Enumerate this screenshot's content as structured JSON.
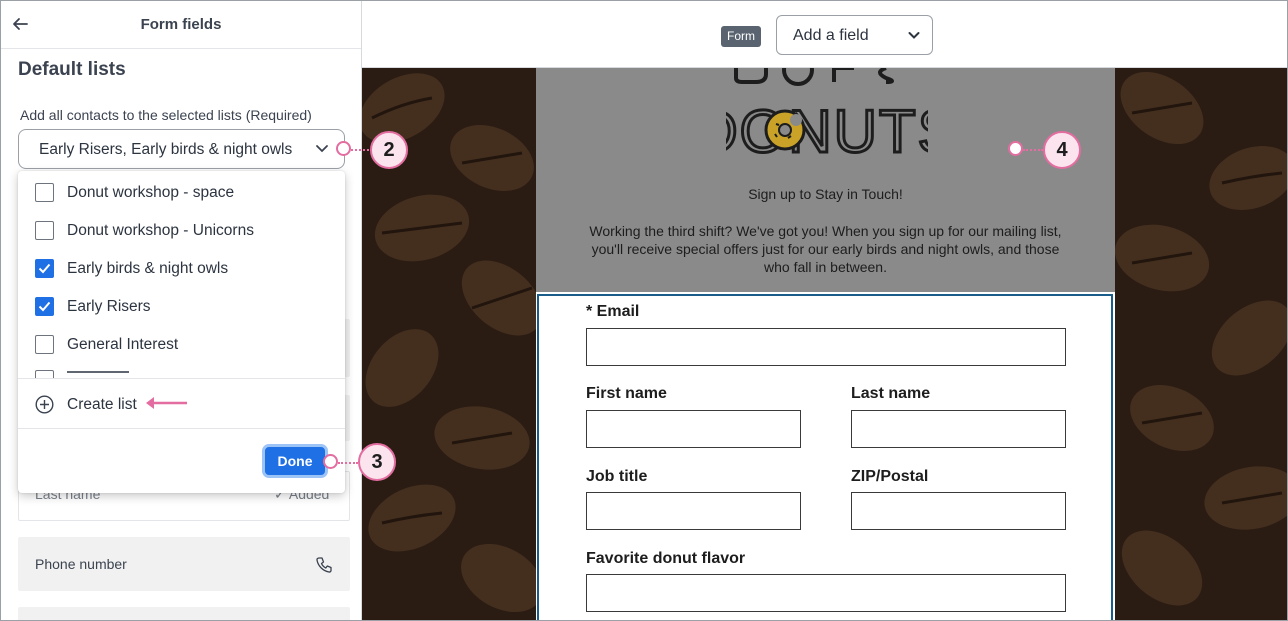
{
  "left_panel": {
    "header_title": "Form fields",
    "section_title": "Default lists",
    "lists_label": "Add all contacts to the selected lists",
    "lists_required": "(Required)",
    "selected_value": "Early Risers, Early birds & night owls",
    "options": [
      {
        "label": "Donut workshop - space",
        "checked": false
      },
      {
        "label": "Donut workshop - Unicorns",
        "checked": false
      },
      {
        "label": "Early birds & night owls",
        "checked": true
      },
      {
        "label": "Early Risers",
        "checked": true
      },
      {
        "label": "General Interest",
        "checked": false
      }
    ],
    "create_list_label": "Create list",
    "done_label": "Done",
    "behind_fields": {
      "last_name_label": "Last name",
      "last_name_status": "Added",
      "phone_label": "Phone number"
    }
  },
  "topbar": {
    "form_badge": "Form",
    "add_field_label": "Add a field"
  },
  "form_preview": {
    "logo_text": "DONUTS",
    "signup_line": "Sign up to Stay in Touch!",
    "intro_text": "Working the third shift? We've got you! When you sign up for our mailing list, you'll receive special offers just for our early birds and night owls, and those who fall in between.",
    "fields": {
      "email": "* Email",
      "first_name": "First name",
      "last_name": "Last name",
      "job_title": "Job title",
      "zip": "ZIP/Postal",
      "favorite": "Favorite donut flavor"
    }
  },
  "callouts": {
    "c2": "2",
    "c3": "3",
    "c4": "4"
  },
  "colors": {
    "primary": "#1f6fe5",
    "callout": "#e36da0",
    "logo": "#c9a227"
  }
}
